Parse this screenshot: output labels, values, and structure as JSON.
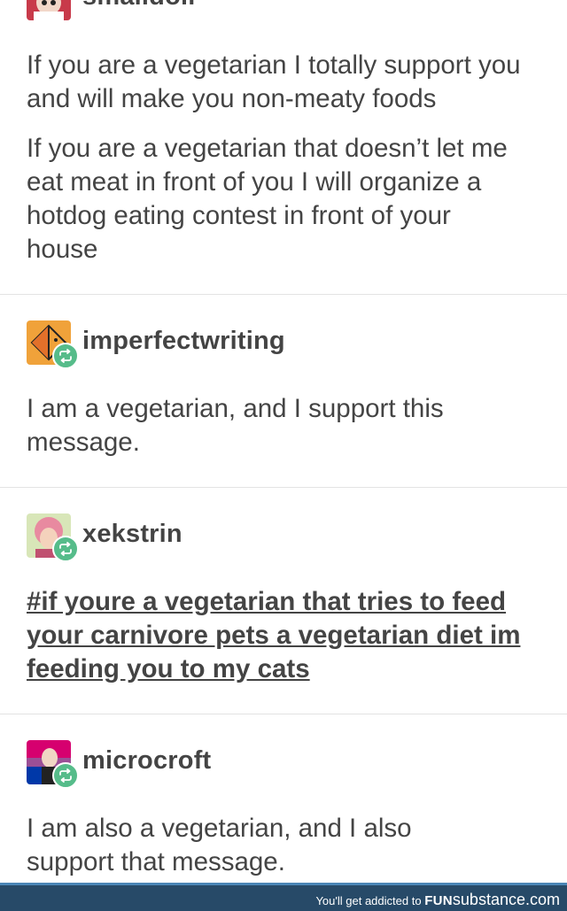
{
  "posts": [
    {
      "username": "smalldoll",
      "paragraphs": [
        "If you are a vegetarian I totally support you and will make you non-meaty foods",
        "If you are a vegetarian that doesn’t let me eat meat in front of you I will organize a hotdog eating contest in front of your house"
      ]
    },
    {
      "username": "imperfectwriting",
      "reblog_icon": "reblog-icon",
      "text": "I am a vegetarian, and I support this message."
    },
    {
      "username": "xekstrin",
      "reblog_icon": "reblog-icon",
      "tags": "#if youre a vegetarian that tries to feed your carnivore pets a vegetarian diet im feeding you to my cats"
    },
    {
      "username": "microcroft",
      "reblog_icon": "reblog-icon",
      "text": "I am also a vegetarian, and I also support that message."
    }
  ],
  "footer": {
    "tagline": "You'll get addicted to",
    "brand_fun": "FUN",
    "brand_substance": "substance",
    "brand_tld": ".com"
  },
  "colors": {
    "text": "#444444",
    "reblog_badge": "#56bc8a",
    "divider": "#e3e3e3",
    "footer_bg": "#274a68"
  }
}
